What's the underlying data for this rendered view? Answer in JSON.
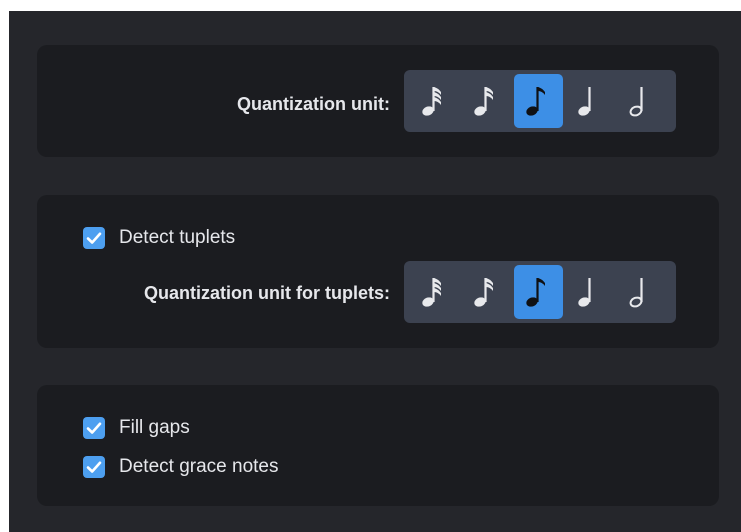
{
  "quantization": {
    "label": "Quantization unit:",
    "options": [
      {
        "icon": "thirty-second-note-icon",
        "selected": false
      },
      {
        "icon": "sixteenth-note-icon",
        "selected": false
      },
      {
        "icon": "eighth-note-icon",
        "selected": true
      },
      {
        "icon": "quarter-note-icon",
        "selected": false
      },
      {
        "icon": "half-note-icon",
        "selected": false
      }
    ]
  },
  "tuplets": {
    "detect_label": "Detect tuplets",
    "detect_checked": true,
    "unit_label": "Quantization unit for tuplets:",
    "options": [
      {
        "icon": "thirty-second-note-icon",
        "selected": false
      },
      {
        "icon": "sixteenth-note-icon",
        "selected": false
      },
      {
        "icon": "eighth-note-icon",
        "selected": true
      },
      {
        "icon": "quarter-note-icon",
        "selected": false
      },
      {
        "icon": "half-note-icon",
        "selected": false
      }
    ]
  },
  "options": {
    "fill_gaps_label": "Fill gaps",
    "fill_gaps_checked": true,
    "grace_notes_label": "Detect grace notes",
    "grace_notes_checked": true
  },
  "colors": {
    "accent": "#3d8fe6",
    "checkbox": "#4d9ff0",
    "panel": "#1b1c20",
    "background": "#25262b",
    "segmented": "#3c4250"
  }
}
